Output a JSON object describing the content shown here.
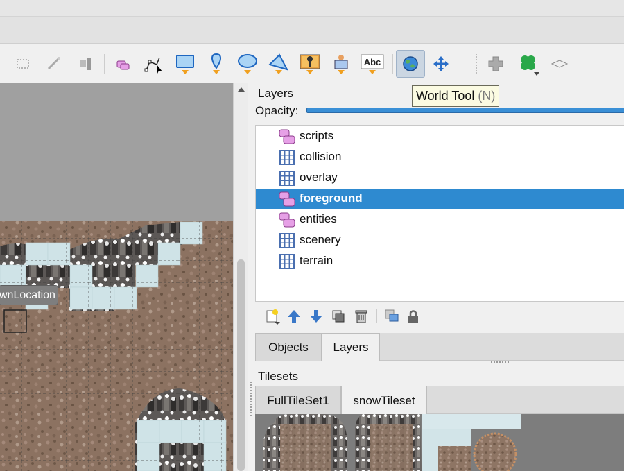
{
  "toolbar": {
    "tools": [
      {
        "name": "select-rectangle-icon"
      },
      {
        "name": "magic-wand-icon"
      },
      {
        "name": "select-same-tile-icon"
      },
      {
        "name": "select-objects-icon"
      },
      {
        "name": "edit-polygons-icon"
      },
      {
        "name": "insert-rectangle-icon"
      },
      {
        "name": "insert-point-icon"
      },
      {
        "name": "insert-ellipse-icon"
      },
      {
        "name": "insert-polygon-icon"
      },
      {
        "name": "insert-tile-icon"
      },
      {
        "name": "insert-template-icon"
      },
      {
        "name": "insert-text-icon",
        "text": "Abc"
      },
      {
        "name": "world-tool-icon",
        "active": true
      },
      {
        "name": "move-icon"
      },
      {
        "name": "stamp-icon"
      },
      {
        "name": "random-icon"
      },
      {
        "name": "wang-icon"
      }
    ],
    "tooltip": {
      "label": "World Tool",
      "shortcut": "(N)"
    }
  },
  "map": {
    "object_label": "wnLocation"
  },
  "layers_panel": {
    "title": "Layers",
    "opacity_label": "Opacity:",
    "opacity_value": 1.0,
    "items": [
      {
        "name": "scripts",
        "type": "object"
      },
      {
        "name": "collision",
        "type": "tile"
      },
      {
        "name": "overlay",
        "type": "tile"
      },
      {
        "name": "foreground",
        "type": "object",
        "selected": true
      },
      {
        "name": "entities",
        "type": "object"
      },
      {
        "name": "scenery",
        "type": "tile"
      },
      {
        "name": "terrain",
        "type": "tile"
      }
    ],
    "tools": [
      "new-layer-icon",
      "raise-layer-icon",
      "lower-layer-icon",
      "duplicate-layer-icon",
      "delete-layer-icon",
      "toggle-other-layers-icon",
      "lock-icon"
    ]
  },
  "panel_tabs": {
    "tabs": [
      {
        "label": "Objects",
        "active": false
      },
      {
        "label": "Layers",
        "active": true
      }
    ]
  },
  "tilesets": {
    "title": "Tilesets",
    "tabs": [
      {
        "label": "FullTileSet1",
        "active": false
      },
      {
        "label": "snowTileset",
        "active": true
      }
    ]
  },
  "colors": {
    "selection": "#2e8ad0",
    "accent": "#3a8fd6",
    "object_layer": "#d47ad6",
    "tile_layer": "#4a6fb0"
  }
}
